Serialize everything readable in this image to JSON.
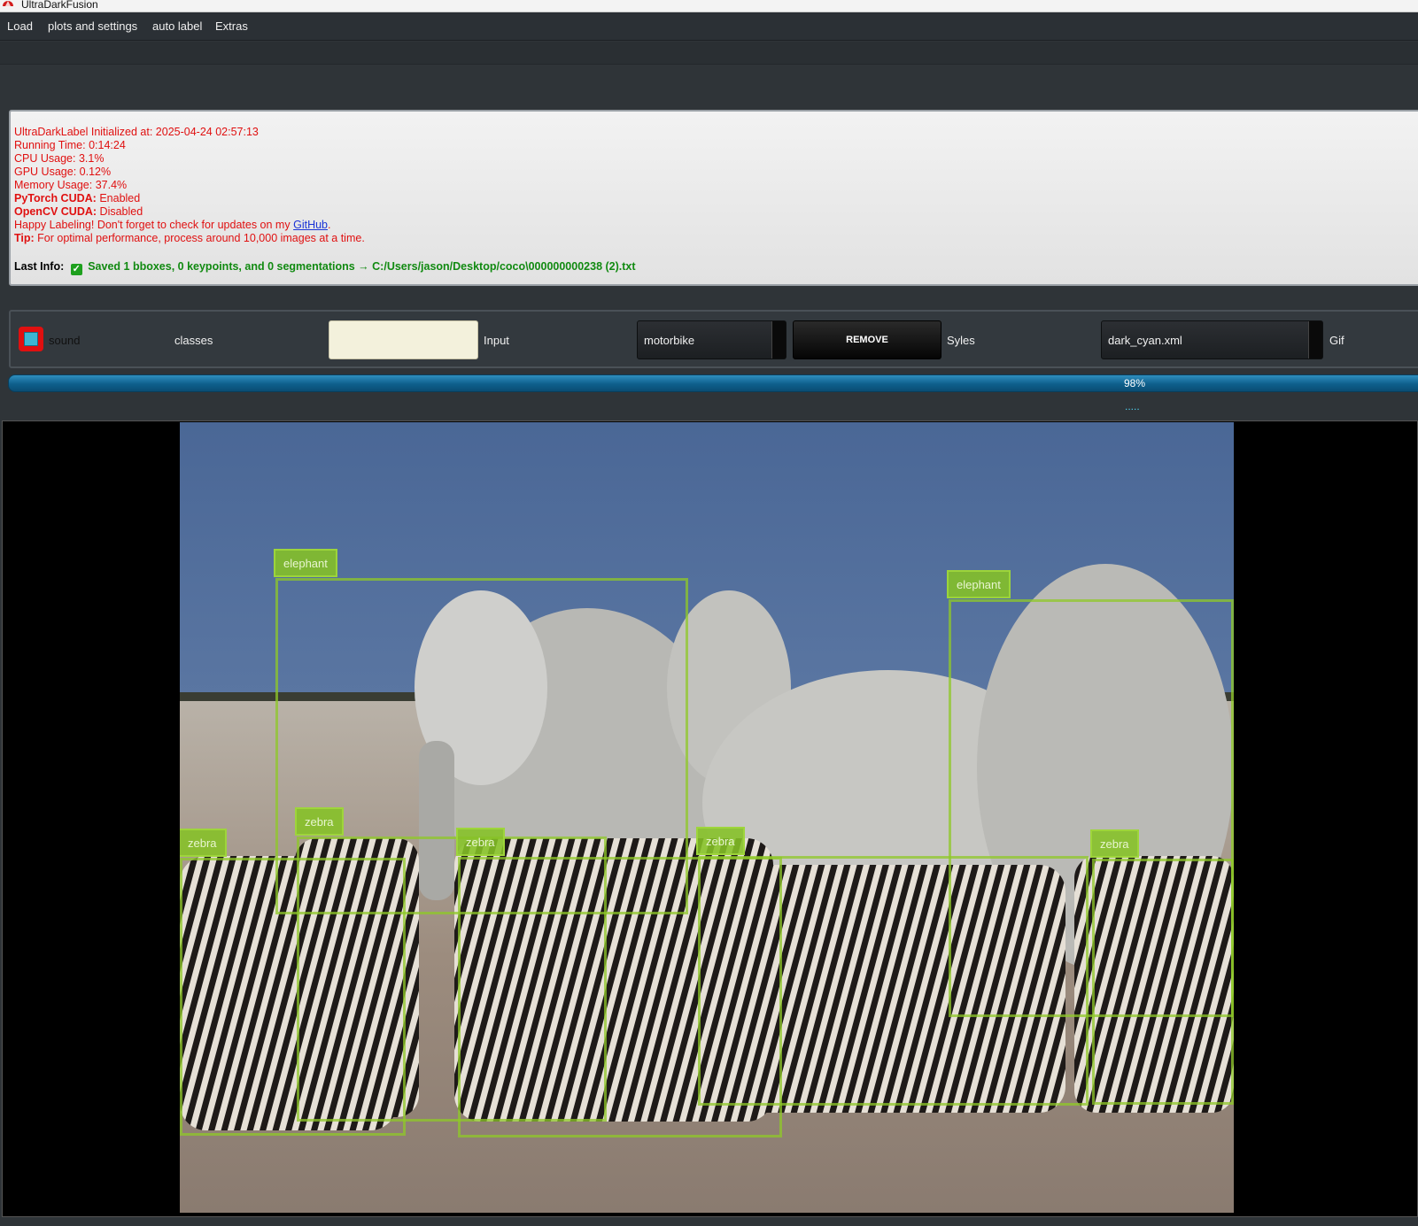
{
  "window": {
    "title": "UltraDarkFusion",
    "icon": "umbrella-icon"
  },
  "menu": {
    "load": "Load",
    "plots": "plots and settings",
    "auto_label": "auto label",
    "extras": "Extras"
  },
  "info": {
    "initialized": "UltraDarkLabel Initialized at: 2025-04-24 02:57:13",
    "running_time": "Running Time: 0:14:24",
    "cpu": "CPU Usage: 3.1%",
    "gpu": "GPU Usage: 0.12%",
    "memory": "Memory Usage: 37.4%",
    "pytorch_label": "PyTorch CUDA:",
    "pytorch_value": "Enabled",
    "opencv_label": "OpenCV CUDA:",
    "opencv_value": "Disabled",
    "happy_text": "Happy Labeling! Don't forget to check for updates on my",
    "github_link": "GitHub",
    "tip_label": "Tip:",
    "tip_text": "For optimal performance, process around 10,000 images at a time.",
    "last_info_label": "Last Info:",
    "last_info_msg": "Saved 1 bboxes, 0 keypoints, and 0 segmentations → C:/Users/jason/Desktop/coco\\000000000238 (2).txt",
    "accent_red": "#e01010",
    "success_green": "#118a11"
  },
  "controls": {
    "sound_label": "sound",
    "sound_checked": true,
    "classes_label": "classes",
    "input_value": "",
    "input_label": "Input",
    "class_combo_value": "motorbike",
    "remove_button": "REMOVE",
    "styles_label": "Syles",
    "style_combo_value": "dark_cyan.xml",
    "gif_label": "Gif"
  },
  "progress": {
    "value": 0.98,
    "text": "98%",
    "status_dots": "....."
  },
  "annotations": [
    {
      "label": "elephant"
    },
    {
      "label": "elephant"
    },
    {
      "label": "zebra"
    },
    {
      "label": "zebra"
    },
    {
      "label": "zebra"
    },
    {
      "label": "zebra"
    },
    {
      "label": "zebra"
    }
  ]
}
